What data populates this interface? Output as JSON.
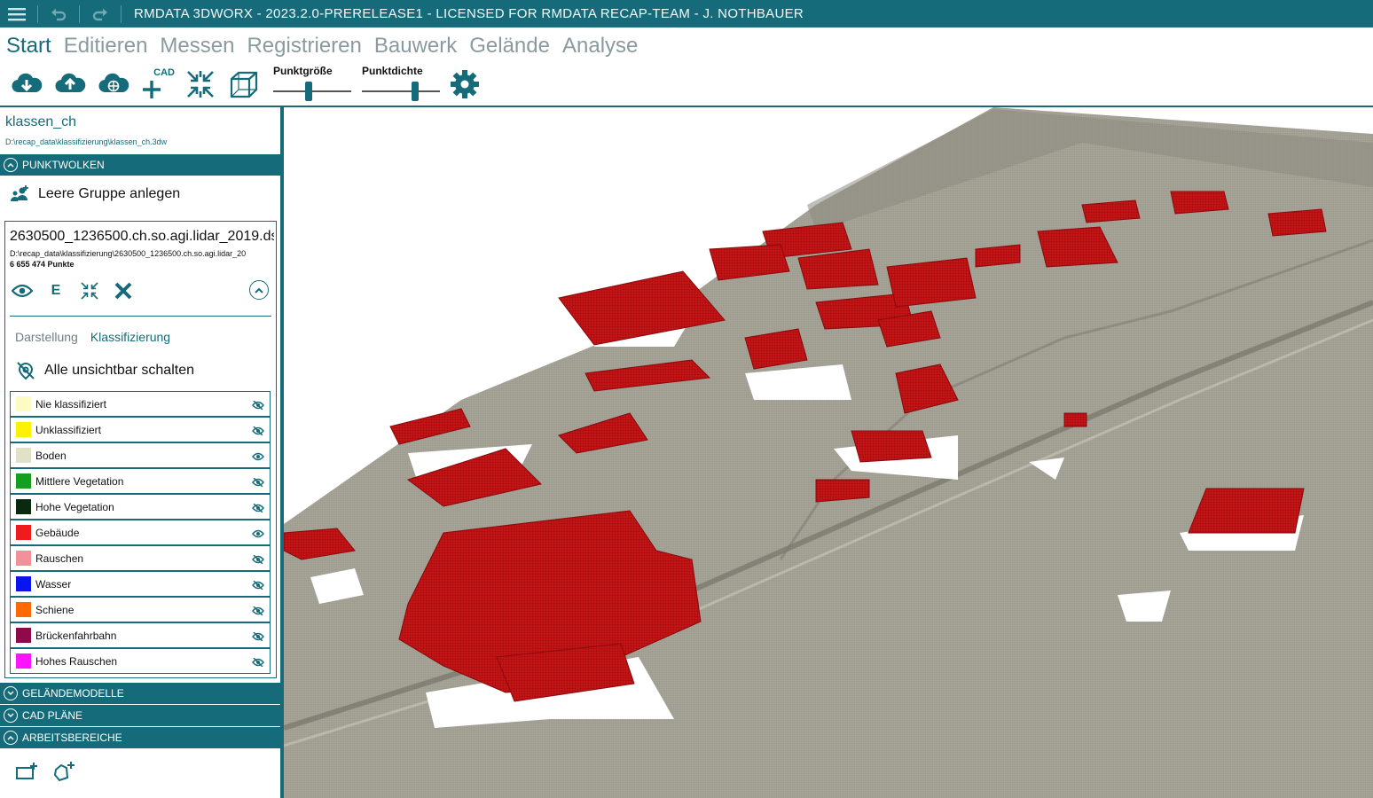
{
  "app": {
    "title": "RMDATA 3DWORX - 2023.2.0-PRERELEASE1 - LICENSED FOR RMDATA RECAP-TEAM - J. NOTHBAUER"
  },
  "menu": {
    "tabs": [
      {
        "label": "Start"
      },
      {
        "label": "Editieren"
      },
      {
        "label": "Messen"
      },
      {
        "label": "Registrieren"
      },
      {
        "label": "Bauwerk"
      },
      {
        "label": "Gelände"
      },
      {
        "label": "Analyse"
      }
    ]
  },
  "toolbar": {
    "cad_label": "CAD",
    "punktgroesse_label": "Punktgröße",
    "punktgroesse_value": 0.45,
    "punktdichte_label": "Punktdichte",
    "punktdichte_value": 0.7
  },
  "project": {
    "name": "klassen_ch",
    "path": "D:\\recap_data\\klassifizierung\\klassen_ch.3dw"
  },
  "sections": {
    "punktwolken": "PUNKTWOLKEN",
    "gelaendemodelle": "GELÄNDEMODELLE",
    "cad_plaene": "CAD PLÄNE",
    "arbeitsbereiche": "ARBEITSBEREICHE"
  },
  "leere_gruppe": "Leere Gruppe anlegen",
  "cloud": {
    "name": "2630500_1236500.ch.so.agi.lidar_2019.ds",
    "path": "D:\\recap_data\\klassifizierung\\2630500_1236500.ch.so.agi.lidar_20",
    "count": "6 655 474 Punkte",
    "edit_label": "E"
  },
  "subtabs": {
    "darstellung": "Darstellung",
    "klassifizierung": "Klassifizierung"
  },
  "alle_unsichtbar": "Alle unsichtbar schalten",
  "classes": [
    {
      "label": "Nie klassifiziert",
      "color": "#fdfbc4",
      "visible": false
    },
    {
      "label": "Unklassifiziert",
      "color": "#fff200",
      "visible": false
    },
    {
      "label": "Boden",
      "color": "#e3e0c8",
      "visible": true
    },
    {
      "label": "Mittlere Vegetation",
      "color": "#14a01e",
      "visible": false
    },
    {
      "label": "Hohe Vegetation",
      "color": "#0a2a10",
      "visible": false
    },
    {
      "label": "Gebäude",
      "color": "#ee1c1c",
      "visible": true
    },
    {
      "label": "Rauschen",
      "color": "#f4909a",
      "visible": false
    },
    {
      "label": "Wasser",
      "color": "#0a14ee",
      "visible": false
    },
    {
      "label": "Schiene",
      "color": "#ff6a00",
      "visible": false
    },
    {
      "label": "Brückenfahrbahn",
      "color": "#8e0a48",
      "visible": false
    },
    {
      "label": "Hohes Rauschen",
      "color": "#ff14ff",
      "visible": false
    }
  ],
  "colors": {
    "accent": "#156b79",
    "building": "#d01214",
    "terrain": "#9c9a8c"
  }
}
